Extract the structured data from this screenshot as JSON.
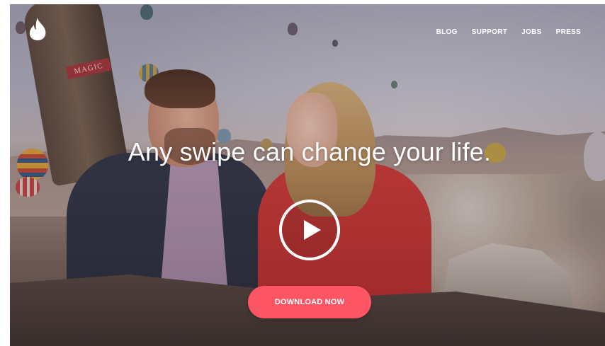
{
  "nav": {
    "items": [
      "BLOG",
      "SUPPORT",
      "JOBS",
      "PRESS"
    ]
  },
  "hero": {
    "headline": "Any swipe can change your life.",
    "cta_label": "DOWNLOAD NOW",
    "basket_label": "MAGIC"
  },
  "icons": {
    "logo": "flame-icon",
    "play": "play-icon"
  },
  "colors": {
    "brand": "#fd5564",
    "text": "#ffffff"
  }
}
